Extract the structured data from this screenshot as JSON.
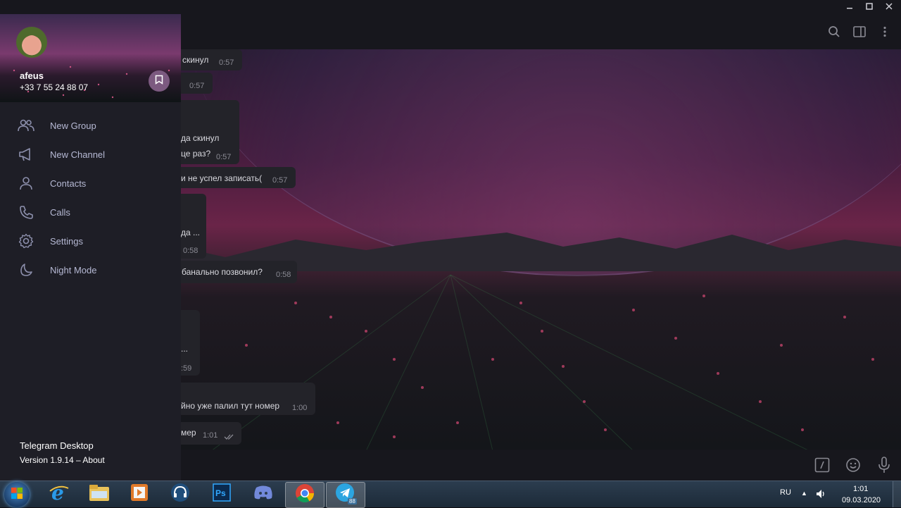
{
  "window": {
    "controls": [
      "minimize",
      "maximize",
      "close"
    ]
  },
  "header": {
    "icons": [
      "search-icon",
      "sidebar-toggle-icon",
      "more-vert-icon"
    ]
  },
  "messages": [
    {
      "text": "скинул",
      "time": "0:57"
    },
    {
      "text": "",
      "time": "0:57"
    },
    {
      "text": "да скинул",
      "time": ""
    },
    {
      "text": "це раз?",
      "time": "0:57"
    },
    {
      "text": "и не успел записать(",
      "time": "0:57"
    },
    {
      "text": "да ...",
      "time": ""
    },
    {
      "text": "",
      "time": "0:58"
    },
    {
      "text": "банально позвонил?",
      "time": "0:58"
    },
    {
      "text": "...",
      "time": ""
    },
    {
      "text": "",
      "time": ":59"
    },
    {
      "text": "йно уже палил тут номер",
      "time": "1:00"
    },
    {
      "text": "мер",
      "time": "1:01"
    }
  ],
  "composer": {
    "icons": [
      "commands-icon",
      "emoji-icon",
      "microphone-icon"
    ]
  },
  "drawer": {
    "user": {
      "name": "afeus",
      "phone": "+33 7 55 24 88 07"
    },
    "menu": [
      {
        "label": "New Group",
        "icon": "new-group-icon"
      },
      {
        "label": "New Channel",
        "icon": "new-channel-icon"
      },
      {
        "label": "Contacts",
        "icon": "contacts-icon"
      },
      {
        "label": "Calls",
        "icon": "calls-icon"
      },
      {
        "label": "Settings",
        "icon": "settings-icon"
      },
      {
        "label": "Night Mode",
        "icon": "night-mode-icon"
      }
    ],
    "app_name": "Telegram Desktop",
    "version": "Version 1.9.14 – About"
  },
  "taskbar": {
    "apps": [
      "internet-explorer",
      "file-explorer",
      "media-player",
      "headset-app",
      "photoshop",
      "discord",
      "chrome",
      "telegram"
    ],
    "telegram_badge": "88",
    "language": "RU",
    "time": "1:01",
    "date": "09.03.2020"
  },
  "colors": {
    "accent": "#7c5a80",
    "menu_text": "#b6b9d4",
    "drawer_bg": "#1e1e26"
  }
}
